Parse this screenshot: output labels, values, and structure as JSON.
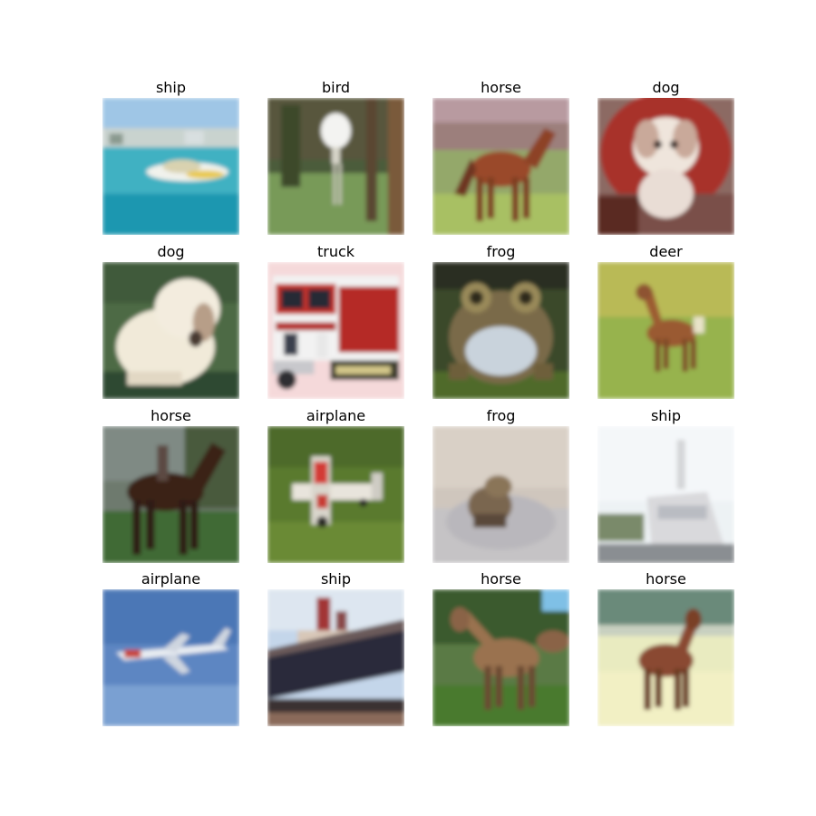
{
  "images": [
    {
      "label": "ship",
      "scene": "ship-sea"
    },
    {
      "label": "bird",
      "scene": "bird-forest"
    },
    {
      "label": "horse",
      "scene": "horse-field"
    },
    {
      "label": "dog",
      "scene": "dog-chair"
    },
    {
      "label": "dog",
      "scene": "dog-grass"
    },
    {
      "label": "truck",
      "scene": "firetruck"
    },
    {
      "label": "frog",
      "scene": "frog-closeup"
    },
    {
      "label": "deer",
      "scene": "deer-field"
    },
    {
      "label": "horse",
      "scene": "horse-dark"
    },
    {
      "label": "airplane",
      "scene": "plane-grass"
    },
    {
      "label": "frog",
      "scene": "frog-gravel"
    },
    {
      "label": "ship",
      "scene": "ship-pale"
    },
    {
      "label": "airplane",
      "scene": "plane-sky"
    },
    {
      "label": "ship",
      "scene": "ship-dock"
    },
    {
      "label": "horse",
      "scene": "horse-forest"
    },
    {
      "label": "horse",
      "scene": "horse-bright"
    }
  ]
}
